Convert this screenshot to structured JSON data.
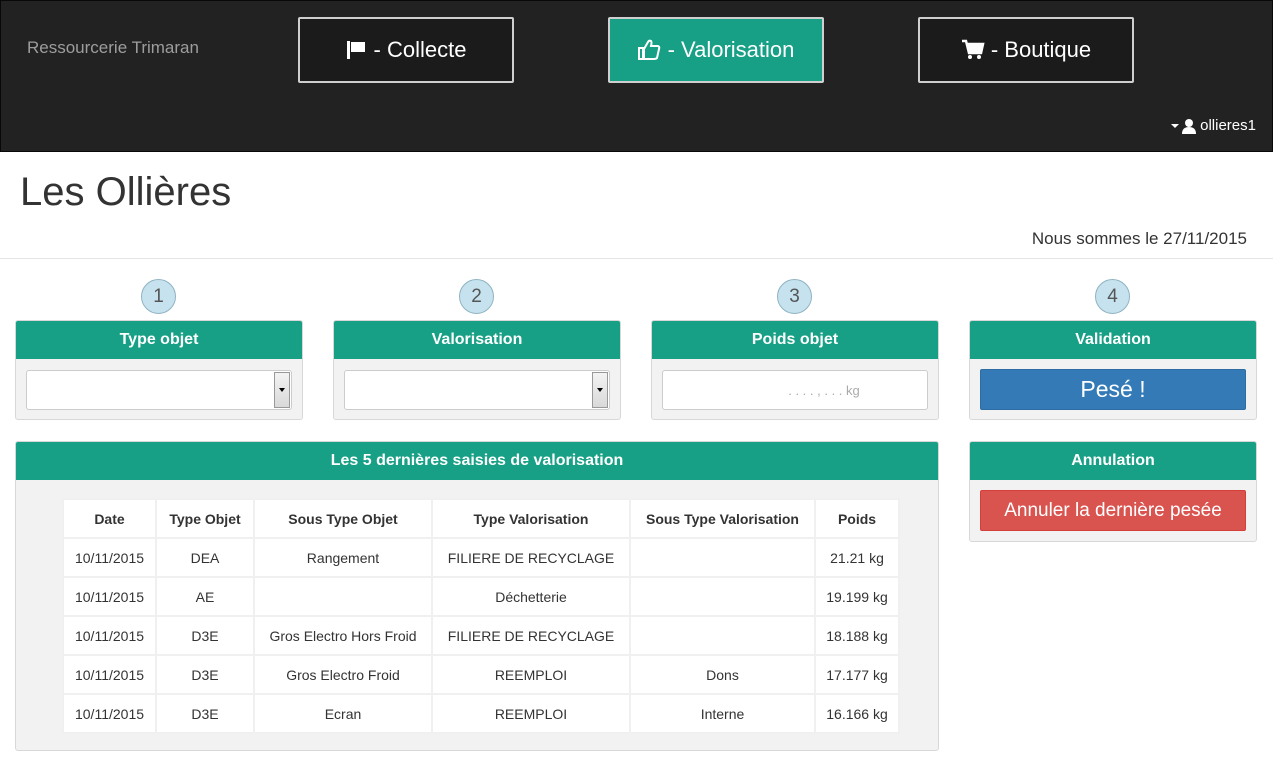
{
  "navbar": {
    "brand": "Ressourcerie Trimaran",
    "buttons": [
      {
        "label": " - Collecte",
        "icon": "flag-icon",
        "active": false
      },
      {
        "label": " - Valorisation",
        "icon": "thumbs-up-icon",
        "active": true
      },
      {
        "label": " - Boutique",
        "icon": "cart-icon",
        "active": false
      }
    ],
    "user": "ollieres1"
  },
  "page": {
    "title": "Les Ollières",
    "date_text": "Nous sommes le 27/11/2015"
  },
  "steps": [
    "1",
    "2",
    "3",
    "4"
  ],
  "panels": {
    "type_objet": {
      "title": "Type objet",
      "value": ""
    },
    "valorisation": {
      "title": "Valorisation",
      "value": ""
    },
    "poids": {
      "title": "Poids objet",
      "placeholder": ". . . . , . . . kg"
    },
    "validation": {
      "title": "Validation",
      "button": "Pesé !"
    },
    "annulation": {
      "title": "Annulation",
      "button": "Annuler la dernière pesée"
    }
  },
  "table": {
    "title": "Les 5 dernières saisies de valorisation",
    "columns": [
      "Date",
      "Type Objet",
      "Sous Type Objet",
      "Type Valorisation",
      "Sous Type Valorisation",
      "Poids"
    ],
    "rows": [
      [
        "10/11/2015",
        "DEA",
        "Rangement",
        "FILIERE DE RECYCLAGE",
        "",
        "21.21 kg"
      ],
      [
        "10/11/2015",
        "AE",
        "",
        "Déchetterie",
        "",
        "19.199 kg"
      ],
      [
        "10/11/2015",
        "D3E",
        "Gros Electro Hors Froid",
        "FILIERE DE RECYCLAGE",
        "",
        "18.188 kg"
      ],
      [
        "10/11/2015",
        "D3E",
        "Gros Electro Froid",
        "REEMPLOI",
        "Dons",
        "17.177 kg"
      ],
      [
        "10/11/2015",
        "D3E",
        "Ecran",
        "REEMPLOI",
        "Interne",
        "16.166 kg"
      ]
    ]
  },
  "colors": {
    "navbar_bg": "#222222",
    "accent_green": "#17a085",
    "primary_blue": "#337ab7",
    "danger_red": "#d9534f"
  }
}
